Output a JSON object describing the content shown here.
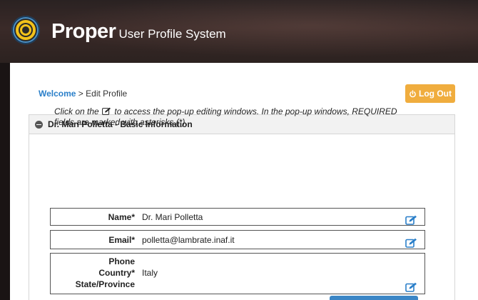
{
  "header": {
    "brand": "Proper",
    "subtitle": "User Profile System"
  },
  "breadcrumb": {
    "home": "Welcome",
    "separator": " > ",
    "current": "Edit Profile"
  },
  "logout": {
    "icon": "power-icon",
    "label": "Log Out"
  },
  "panel": {
    "title": "Dr. Mari Polletta - Basic Information",
    "note_before": "Click on the ",
    "note_after": " to access the pop-up editing windows. In the pop-up windows, REQUIRED fields are marked with asterisks (*)."
  },
  "fields": {
    "name": {
      "label": "Name*",
      "value": "Dr. Mari Polletta"
    },
    "email": {
      "label": "Email*",
      "value": "polletta@lambrate.inaf.it"
    },
    "phone": {
      "label": "Phone"
    },
    "country": {
      "label": "Country*",
      "value": "Italy"
    },
    "state": {
      "label": "State/Province"
    }
  },
  "colors": {
    "accent": "#2a7fc9",
    "logout": "#f0ad3e",
    "edit_icon": "#2a7fc9"
  }
}
